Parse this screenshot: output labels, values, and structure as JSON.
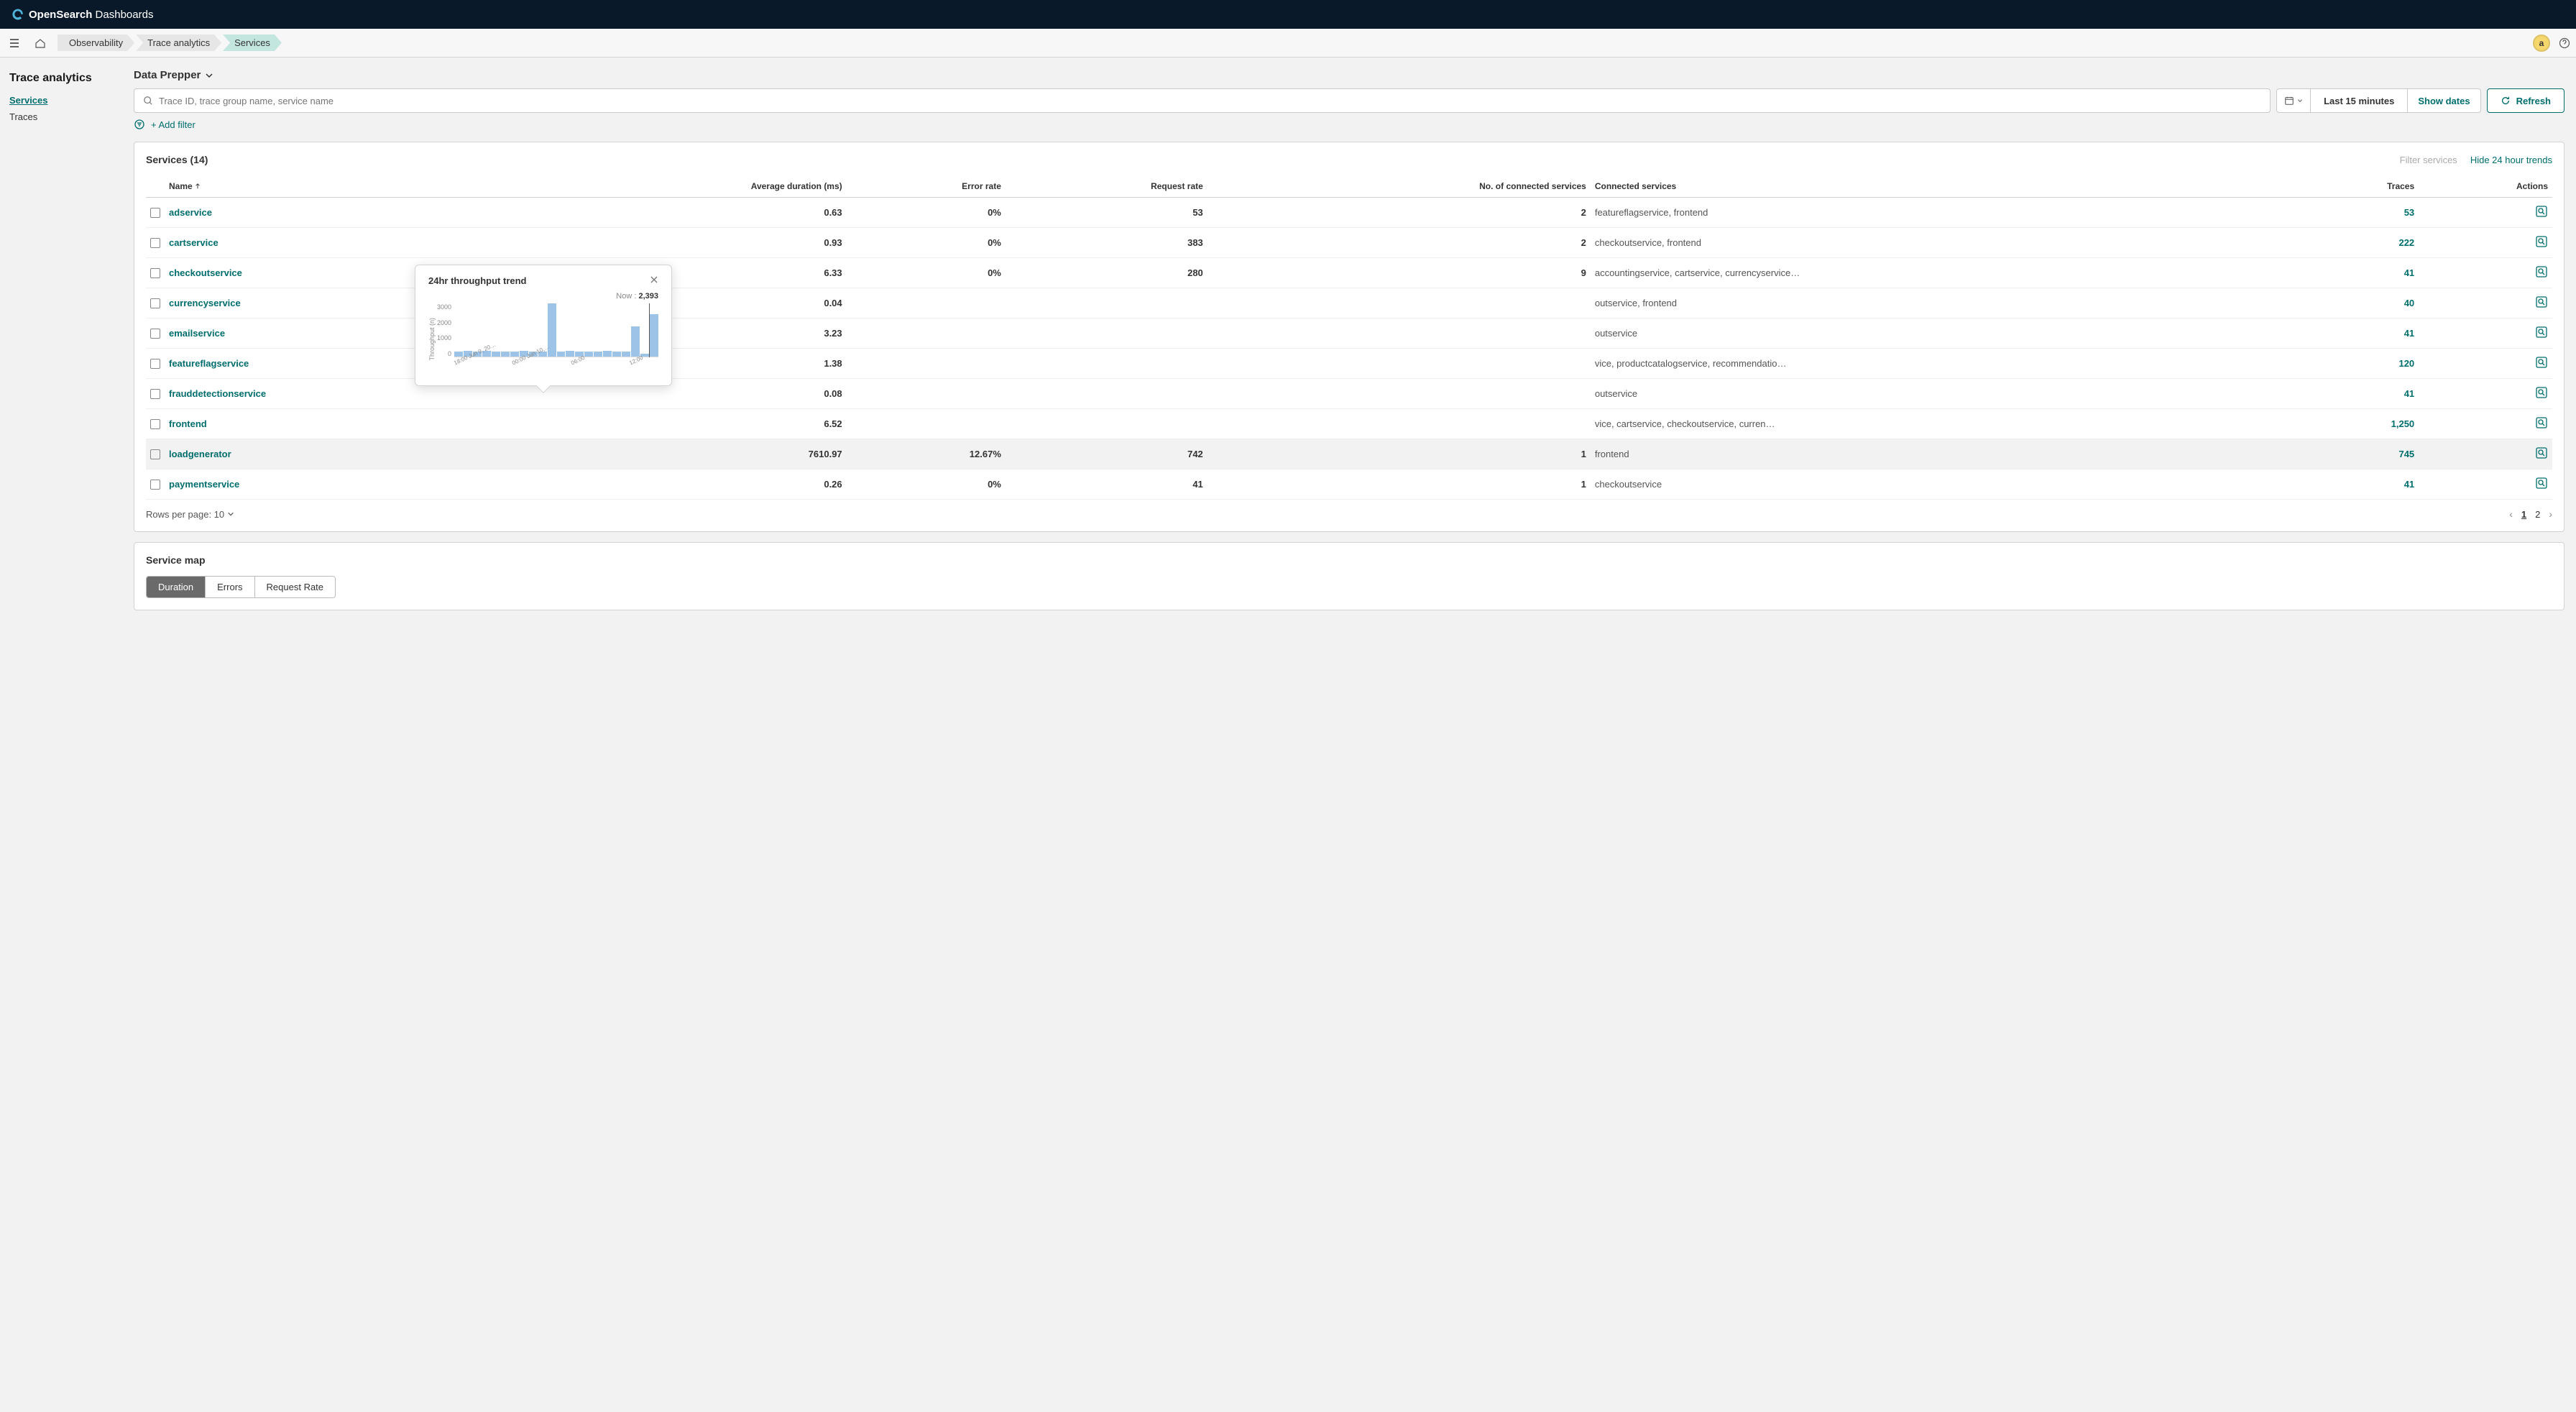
{
  "header": {
    "brand_bold": "Open",
    "brand_mid": "Search",
    "brand_tail": " Dashboards"
  },
  "breadcrumbs": [
    "Observability",
    "Trace analytics",
    "Services"
  ],
  "user": {
    "avatar_letter": "a"
  },
  "sidebar": {
    "title": "Trace analytics",
    "links": [
      {
        "label": "Services",
        "active": true
      },
      {
        "label": "Traces",
        "active": false
      }
    ]
  },
  "mode": "Data Prepper",
  "search": {
    "placeholder": "Trace ID, trace group name, service name"
  },
  "datePicker": {
    "range": "Last 15 minutes",
    "showDates": "Show dates"
  },
  "refresh": "Refresh",
  "addFilter": "+ Add filter",
  "table": {
    "title": "Services",
    "count": "(14)",
    "filterPlaceholder": "Filter services",
    "hideTrends": "Hide 24 hour trends",
    "columns": [
      "Name",
      "Average duration (ms)",
      "Error rate",
      "Request rate",
      "No. of connected services",
      "Connected services",
      "Traces",
      "Actions"
    ],
    "rows": [
      {
        "name": "adservice",
        "avg": "0.63",
        "err": "0%",
        "req": "53",
        "nconn": "2",
        "conn": "featureflagservice, frontend",
        "traces": "53"
      },
      {
        "name": "cartservice",
        "avg": "0.93",
        "err": "0%",
        "req": "383",
        "nconn": "2",
        "conn": "checkoutservice, frontend",
        "traces": "222"
      },
      {
        "name": "checkoutservice",
        "avg": "6.33",
        "err": "0%",
        "req": "280",
        "nconn": "9",
        "conn": "accountingservice, cartservice, currencyservice…",
        "traces": "41"
      },
      {
        "name": "currencyservice",
        "avg": "0.04",
        "err": "",
        "req": "",
        "nconn": "",
        "conn": "outservice, frontend",
        "traces": "40"
      },
      {
        "name": "emailservice",
        "avg": "3.23",
        "err": "",
        "req": "",
        "nconn": "",
        "conn": "outservice",
        "traces": "41"
      },
      {
        "name": "featureflagservice",
        "avg": "1.38",
        "err": "",
        "req": "",
        "nconn": "",
        "conn": "vice, productcatalogservice, recommendatio…",
        "traces": "120"
      },
      {
        "name": "frauddetectionservice",
        "avg": "0.08",
        "err": "",
        "req": "",
        "nconn": "",
        "conn": "outservice",
        "traces": "41"
      },
      {
        "name": "frontend",
        "avg": "6.52",
        "err": "",
        "req": "",
        "nconn": "",
        "conn": "vice, cartservice, checkoutservice, curren…",
        "traces": "1,250"
      },
      {
        "name": "loadgenerator",
        "avg": "7610.97",
        "err": "12.67%",
        "req": "742",
        "nconn": "1",
        "conn": "frontend",
        "traces": "745",
        "highlight": true
      },
      {
        "name": "paymentservice",
        "avg": "0.26",
        "err": "0%",
        "req": "41",
        "nconn": "1",
        "conn": "checkoutservice",
        "traces": "41"
      }
    ],
    "rowsPerPage": "Rows per page: 10",
    "pages": [
      "1",
      "2"
    ]
  },
  "serviceMap": {
    "title": "Service map",
    "segments": [
      "Duration",
      "Errors",
      "Request Rate"
    ]
  },
  "chart_data": {
    "type": "bar",
    "title": "24hr throughput trend",
    "now_label": "Now :",
    "now_value": "2,393",
    "ylabel": "Throughput (n)",
    "ylim": [
      0,
      3000
    ],
    "yticks": [
      0,
      1000,
      2000,
      3000
    ],
    "x_ticks": [
      "18:00 Jun 9, 20…",
      "00:00 Jun 10,…",
      "06:00",
      "12:00"
    ],
    "values": [
      280,
      320,
      300,
      310,
      280,
      300,
      290,
      310,
      300,
      290,
      3200,
      300,
      310,
      300,
      290,
      300,
      310,
      300,
      290,
      1700,
      150,
      2393
    ]
  }
}
